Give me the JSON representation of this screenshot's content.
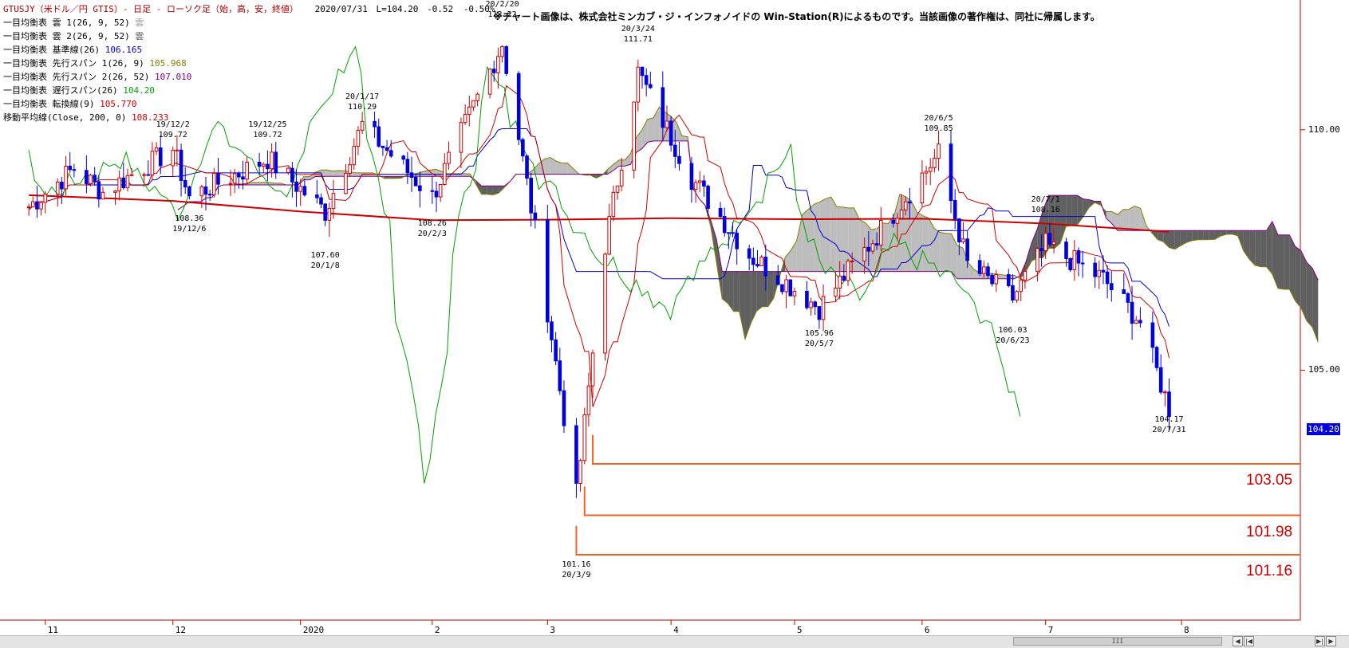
{
  "header": {
    "symbol": "GTUSJY（米ドル／円 GTIS）- 日足 - ローソク足（始，高，安，終値）",
    "date": "2020/07/31",
    "last": "L=104.20",
    "change": "-0.52",
    "change_pct": "-0.50%"
  },
  "notice": "※チャート画像は、株式会社ミンカブ・ジ・インフォノイドの Win-Station(R)によるものです。当該画像の著作権は、同社に帰属します。",
  "legend": [
    {
      "label": "一目均衡表 雲 1(26, 9, 52)",
      "value": "雲",
      "color": "#999999"
    },
    {
      "label": "一目均衡表 雲 2(26, 9, 52)",
      "value": "雲",
      "color": "#555555"
    },
    {
      "label": "一目均衡表 基準線(26)",
      "value": "106.165",
      "color": "#0000cc"
    },
    {
      "label": "一目均衡表 先行スパン 1(26, 9)",
      "value": "105.968",
      "color": "#808000"
    },
    {
      "label": "一目均衡表 先行スパン 2(26, 52)",
      "value": "107.010",
      "color": "#800080"
    },
    {
      "label": "一目均衡表 遅行スパン(26)",
      "value": "104.20",
      "color": "#00a000"
    },
    {
      "label": "一目均衡表 転換線(9)",
      "value": "105.770",
      "color": "#cc0000"
    },
    {
      "label": "移動平均線(Close, 200, 0)",
      "value": "108.233",
      "color": "#cc0000"
    }
  ],
  "chart_data": {
    "type": "line",
    "title": "GTUSJY 日足 ローソク足",
    "y_axis": {
      "ticks": [
        "110.00",
        "105.00"
      ],
      "min": 99.8,
      "max": 112.7
    },
    "x_axis": {
      "ticks": [
        "11",
        "12",
        "2020",
        "2",
        "3",
        "4",
        "5",
        "6",
        "7",
        "8"
      ]
    },
    "last_price_label": "104.20",
    "annotations": [
      {
        "date": "19/12/2",
        "price": "109.72",
        "type": "high"
      },
      {
        "date": "19/12/6",
        "price": "108.36",
        "type": "low"
      },
      {
        "date": "19/12/25",
        "price": "109.72",
        "type": "high"
      },
      {
        "date": "20/1/8",
        "price": "107.60",
        "type": "low"
      },
      {
        "date": "20/1/17",
        "price": "110.29",
        "type": "high"
      },
      {
        "date": "20/2/3",
        "price": "108.26",
        "type": "low"
      },
      {
        "date": "20/2/20",
        "price": "112.22",
        "type": "high"
      },
      {
        "date": "20/3/9",
        "price": "101.16",
        "type": "low"
      },
      {
        "date": "20/3/24",
        "price": "111.71",
        "type": "high"
      },
      {
        "date": "20/5/7",
        "price": "105.96",
        "type": "low"
      },
      {
        "date": "20/6/5",
        "price": "109.85",
        "type": "high"
      },
      {
        "date": "20/6/23",
        "price": "106.03",
        "type": "low"
      },
      {
        "date": "20/7/1",
        "price": "108.16",
        "type": "high"
      },
      {
        "date": "20/7/31",
        "price": "104.17",
        "type": "low"
      }
    ],
    "support_levels": [
      {
        "value": 103.05,
        "label": "103.05"
      },
      {
        "value": 101.98,
        "label": "101.98"
      },
      {
        "value": 101.16,
        "label": "101.16"
      }
    ],
    "series": [
      {
        "name": "移動平均線(Close, 200, 0)",
        "color": "#cc0000",
        "x": [
          "2019-10-28",
          "2019-12-02",
          "2020-01-02",
          "2020-02-03",
          "2020-03-02",
          "2020-04-01",
          "2020-05-01",
          "2020-06-01",
          "2020-07-01",
          "2020-07-31"
        ],
        "values": [
          108.64,
          108.52,
          108.3,
          108.12,
          108.13,
          108.16,
          108.14,
          108.15,
          108.05,
          107.88
        ]
      },
      {
        "name": "終値(概算)",
        "color": "#0000dd",
        "x": [
          "2019-10-28",
          "2019-11-08",
          "2019-11-15",
          "2019-12-02",
          "2019-12-06",
          "2019-12-25",
          "2020-01-08",
          "2020-01-17",
          "2020-02-03",
          "2020-02-20",
          "2020-02-28",
          "2020-03-09",
          "2020-03-16",
          "2020-03-24",
          "2020-04-06",
          "2020-04-20",
          "2020-05-07",
          "2020-05-20",
          "2020-06-05",
          "2020-06-12",
          "2020-06-23",
          "2020-07-01",
          "2020-07-15",
          "2020-07-24",
          "2020-07-31"
        ],
        "values": [
          108.4,
          109.2,
          108.7,
          109.6,
          108.6,
          109.4,
          108.3,
          110.1,
          108.6,
          111.8,
          107.9,
          102.4,
          107.6,
          111.2,
          109.0,
          107.4,
          106.3,
          107.7,
          109.5,
          107.2,
          106.5,
          107.6,
          106.9,
          106.0,
          104.2
        ]
      }
    ]
  },
  "icons": {
    "left": "scroll-left-icon",
    "right": "scroll-right-icon"
  },
  "scrollbar": {
    "thumb_grip": "III"
  }
}
